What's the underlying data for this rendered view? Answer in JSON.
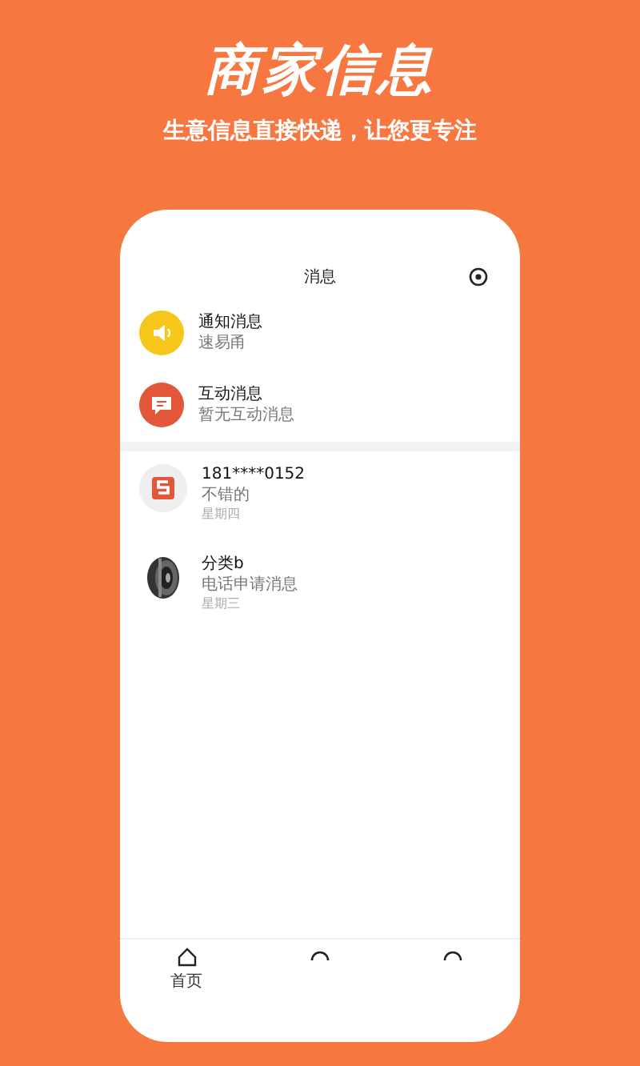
{
  "promo": {
    "title": "商家信息",
    "subtitle": "生意信息直接快递，让您更专注"
  },
  "screen": {
    "title": "消息"
  },
  "notices": [
    {
      "kind": "notify",
      "title": "通知消息",
      "preview": "速易甬"
    },
    {
      "kind": "interaction",
      "title": "互动消息",
      "preview": "暂无互动消息"
    }
  ],
  "conversations": [
    {
      "kind": "logo",
      "name": "181****0152",
      "message": "不错的",
      "day": "星期四"
    },
    {
      "kind": "picture",
      "name": "分类b",
      "message": "电话申请消息",
      "day": "星期三"
    }
  ],
  "tab_bar": [
    {
      "kind": "home",
      "label": "首页"
    },
    {
      "kind": "circle"
    },
    {
      "kind": "circle"
    }
  ]
}
